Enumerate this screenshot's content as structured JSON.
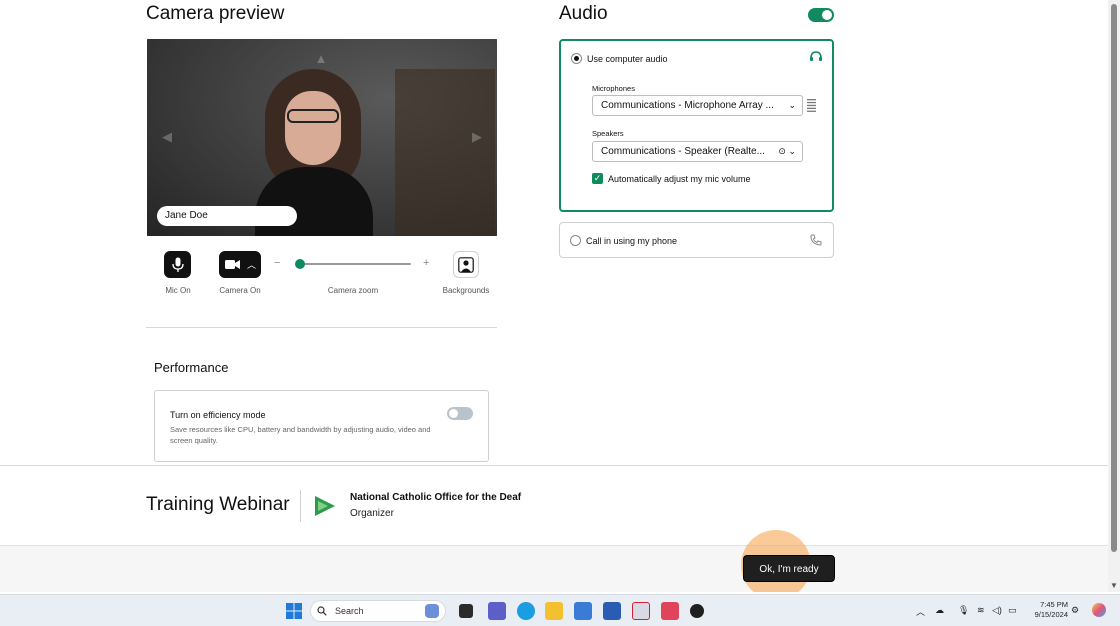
{
  "camera": {
    "title": "Camera preview",
    "participant_name": "Jane Doe",
    "mic_label": "Mic On",
    "camera_label": "Camera On",
    "zoom_label": "Camera zoom",
    "zoom_minus": "−",
    "zoom_plus": "+",
    "zoom_level": 0.0,
    "backgrounds_label": "Backgrounds"
  },
  "performance": {
    "title": "Performance",
    "efficiency_title": "Turn on efficiency mode",
    "efficiency_desc": "Save resources like CPU, battery and bandwidth by adjusting audio, video and screen quality.",
    "efficiency_on": false
  },
  "audio": {
    "title": "Audio",
    "enabled": true,
    "computer_audio_label": "Use computer audio",
    "microphones_label": "Microphones",
    "microphone_value": "Communications - Microphone Array ...",
    "speakers_label": "Speakers",
    "speaker_value": "Communications - Speaker (Realte...",
    "auto_adjust_label": "Automatically adjust my mic volume",
    "auto_adjust_checked": true,
    "phone_label": "Call in using my phone"
  },
  "footer": {
    "webinar_title": "Training Webinar",
    "organizer_name": "National Catholic Office for the Deaf",
    "organizer_role": "Organizer",
    "ready_button": "Ok, I'm ready"
  },
  "taskbar": {
    "search_placeholder": "Search",
    "time": "7:45 PM",
    "date": "9/15/2024"
  },
  "colors": {
    "accent_green": "#118a5e",
    "ready_button_bg": "#1f1f1f",
    "highlight_halo": "#f6a046"
  }
}
